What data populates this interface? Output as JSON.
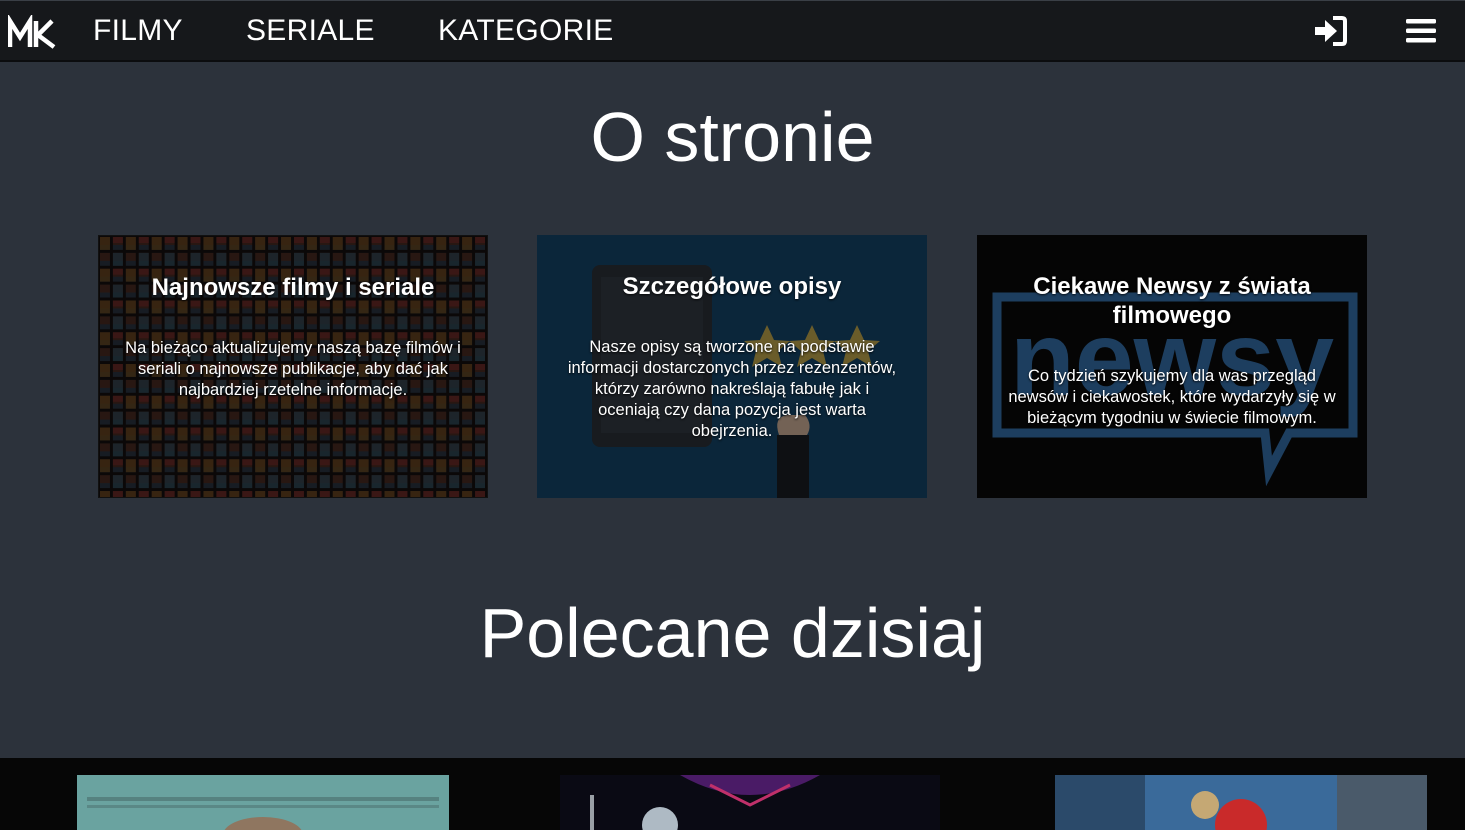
{
  "header": {
    "logo_text": "MK",
    "nav": [
      {
        "label": "FILMY"
      },
      {
        "label": "SERIALE"
      },
      {
        "label": "KATEGORIE"
      }
    ]
  },
  "about": {
    "title": "O stronie",
    "cards": [
      {
        "title": "Najnowsze filmy i seriale",
        "text": "Na bieżąco aktualizujemy naszą bazę filmów i seriali o najnowsze publikacje, aby dać jak najbardziej rzetelne informacje."
      },
      {
        "title": "Szczegółowe opisy",
        "text": "Nasze opisy są tworzone na podstawie informacji dostarczonych przez rezenzentów, którzy zarówno nakreślają fabułę jak i oceniają czy dana pozycja jest warta obejrzenia."
      },
      {
        "title": "Ciekawe Newsy z świata filmowego",
        "text": "Co tydzień szykujemy dla was przegląd newsów i ciekawostek, które wydarzyły się w bieżącym tygodniu w świecie filmowym.",
        "bg_word": "newsy"
      }
    ]
  },
  "recommended": {
    "title": "Polecane dzisiaj"
  },
  "colors": {
    "page_bg": "#2c323b",
    "header_bg": "#16181b",
    "card2_bg": "#0e3049",
    "newsy_blue": "#1d3e5f"
  }
}
